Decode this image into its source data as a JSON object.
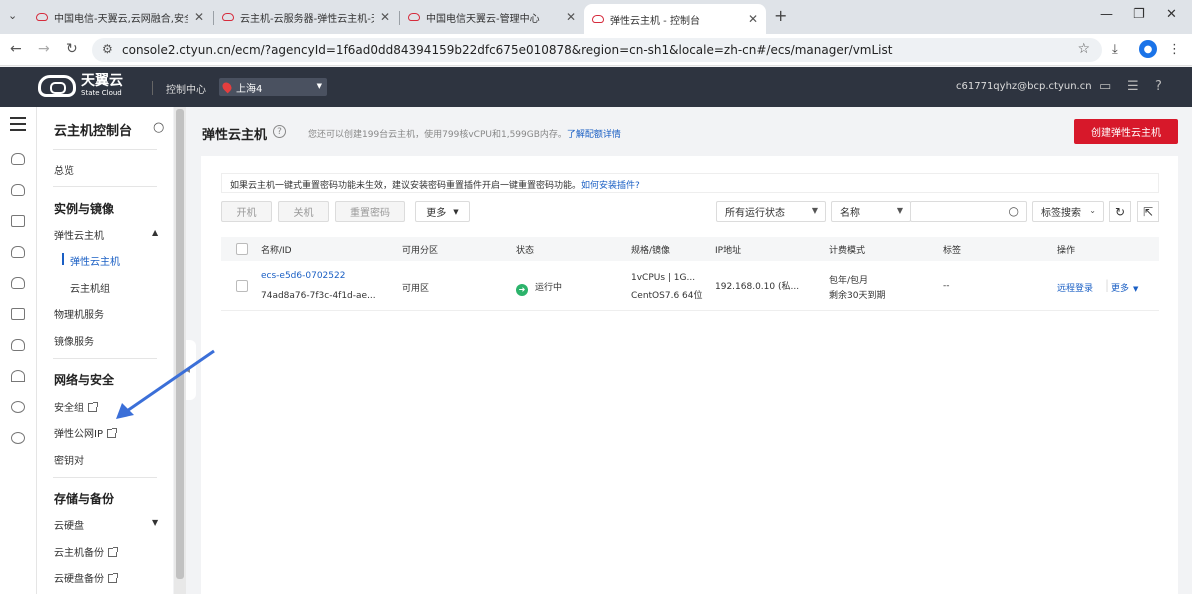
{
  "browser": {
    "tabs": [
      {
        "title": "中国电信-天翼云,云网融合,安全"
      },
      {
        "title": "云主机-云服务器-弹性云主机-天"
      },
      {
        "title": "中国电信天翼云-管理中心"
      },
      {
        "title": "弹性云主机 - 控制台"
      }
    ],
    "url": "console2.ctyun.cn/ecm/?agencyId=1f6ad0dd84394159b22dfc675e010878&region=cn-sh1&locale=zh-cn#/ecs/manager/vmList"
  },
  "header": {
    "brand": "天翼云",
    "brand_sub": "State Cloud",
    "console": "控制中心",
    "region": "上海4",
    "user": "c61771qyhz@bcp.ctyun.cn"
  },
  "sidebar": {
    "title": "云主机控制台",
    "overview": "总览",
    "group1": "实例与镜像",
    "ecs": "弹性云主机",
    "ecs_sub": "弹性云主机",
    "ecs_group": "云主机组",
    "bare_metal": "物理机服务",
    "image": "镜像服务",
    "group2": "网络与安全",
    "security_group": "安全组",
    "eip": "弹性公网IP",
    "keypair": "密钥对",
    "group3": "存储与备份",
    "disk": "云硬盘",
    "ecs_backup": "云主机备份",
    "disk_backup": "云硬盘备份"
  },
  "main": {
    "title": "弹性云主机",
    "quota_text": "您还可以创建199台云主机，使用799核vCPU和1,599GB内存。",
    "quota_link": "了解配额详情",
    "create_button": "创建弹性云主机",
    "notice_text": "如果云主机一键式重置密码功能未生效，建议安装密码重置插件开启一键重置密码功能。",
    "notice_link": "如何安装插件?",
    "toolbar": {
      "start": "开机",
      "stop": "关机",
      "reset_pwd": "重置密码",
      "more": "更多",
      "status_filter": "所有运行状态",
      "name_filter": "名称",
      "tag_search": "标签搜索"
    },
    "columns": [
      "名称/ID",
      "可用分区",
      "状态",
      "规格/镜像",
      "IP地址",
      "计费模式",
      "标签",
      "操作"
    ],
    "rows": [
      {
        "name": "ecs-e5d6-0702522",
        "id": "74ad8a76-7f3c-4f1d-ae...",
        "zone": "可用区",
        "status": "运行中",
        "spec": "1vCPUs | 1G...",
        "image": "CentOS7.6 64位",
        "ip": "192.168.0.10 (私...",
        "billing": "包年/包月",
        "expire": "剩余30天到期",
        "tag": "--",
        "remote_login": "远程登录",
        "more": "更多"
      }
    ]
  },
  "colors": {
    "header_bg": "#2e3440",
    "accent_red": "#d7182a",
    "link_blue": "#1a5fc4",
    "running_green": "#2cb36b"
  }
}
